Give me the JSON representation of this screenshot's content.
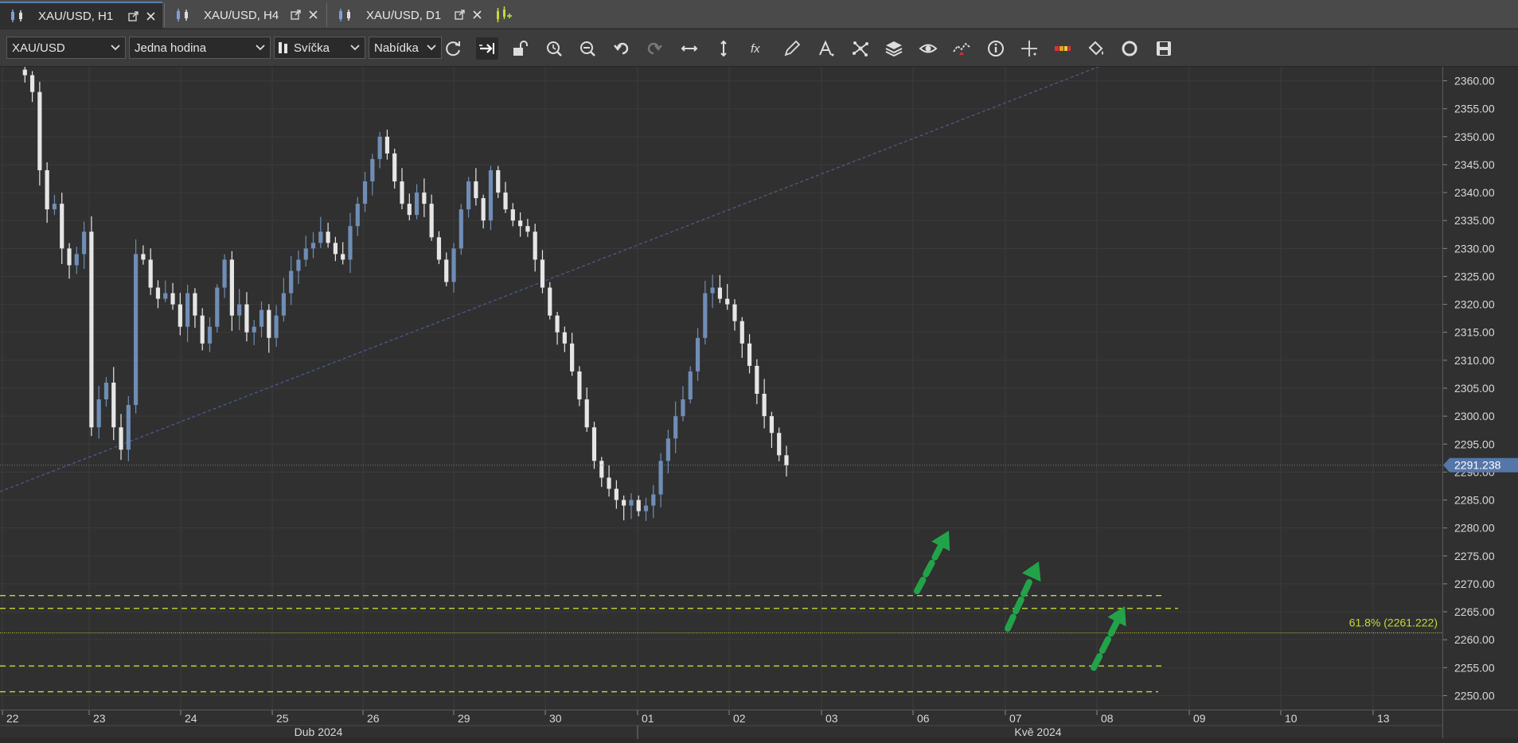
{
  "tabs": [
    {
      "label": "XAU/USD, H1",
      "active": true
    },
    {
      "label": "XAU/USD, H4",
      "active": false
    },
    {
      "label": "XAU/USD, D1",
      "active": false
    }
  ],
  "toolbar": {
    "instrument": "XAU/USD",
    "period": "Jedna hodina",
    "chart_type": "Svíčka",
    "price_side": "Nabídka",
    "icons": [
      "refresh-icon",
      "shift-chart-icon",
      "lock-icon",
      "zoom-clock-icon",
      "zoom-out-icon",
      "undo-icon",
      "redo-icon",
      "horizontal-resize-icon",
      "vertical-resize-icon",
      "fx-indicators-icon",
      "pencil-icon",
      "text-tool-icon",
      "patterns-icon",
      "layers-icon",
      "eye-icon",
      "signals-icon",
      "info-icon",
      "crosshair-icon",
      "heatmap-icon",
      "paint-bucket-icon",
      "circle-refresh-icon",
      "save-icon"
    ]
  },
  "chart_data": {
    "type": "candlestick",
    "ylim": [
      2247.5,
      2362.5
    ],
    "y_ticks": [
      "2250.00",
      "2255.00",
      "2260.00",
      "2265.00",
      "2270.00",
      "2275.00",
      "2280.00",
      "2285.00",
      "2290.00",
      "2295.00",
      "2300.00",
      "2305.00",
      "2310.00",
      "2315.00",
      "2320.00",
      "2325.00",
      "2330.00",
      "2335.00",
      "2340.00",
      "2345.00",
      "2350.00",
      "2355.00",
      "2360.00"
    ],
    "x_days": [
      "22",
      "23",
      "24",
      "25",
      "26",
      "29",
      "30",
      "01",
      "02",
      "03",
      "06",
      "07",
      "08",
      "09",
      "10",
      "13"
    ],
    "x_months": [
      "Dub 2024",
      "Kvě 2024"
    ],
    "current_price": "2291.238",
    "fib_label": "61.8% (2261.222)",
    "fib_level": 2261.222,
    "dashed_levels": [
      2267.9,
      2265.6,
      2255.3,
      2250.7
    ],
    "close_path": [
      2362,
      2361,
      2358,
      2344,
      2337,
      2338,
      2330,
      2327,
      2329,
      2333,
      2298,
      2303,
      2306,
      2298,
      2294,
      2302,
      2329,
      2328,
      2323,
      2321,
      2322,
      2320,
      2316,
      2322,
      2318,
      2313,
      2316,
      2323,
      2328,
      2318,
      2320,
      2315,
      2316,
      2319,
      2314,
      2318,
      2322,
      2326,
      2328,
      2330,
      2331,
      2333,
      2331,
      2329,
      2328,
      2334,
      2338,
      2342,
      2346,
      2350,
      2347,
      2342,
      2338,
      2336,
      2340,
      2338,
      2332,
      2328,
      2324,
      2330,
      2337,
      2342,
      2339,
      2335,
      2344,
      2340,
      2337,
      2335,
      2334,
      2333,
      2328,
      2323,
      2318,
      2315,
      2313,
      2308,
      2303,
      2298,
      2292,
      2289,
      2287,
      2285,
      2284,
      2285,
      2283,
      2284,
      2286,
      2292,
      2296,
      2300,
      2303,
      2308,
      2314,
      2322,
      2323,
      2321,
      2320,
      2317,
      2313,
      2309,
      2304,
      2300,
      2297,
      2293,
      2291.2
    ]
  },
  "colors": {
    "bull": "#6f8db5",
    "bear": "#e6e6e6",
    "fib": "#c9d83a",
    "arrow": "#22a34a",
    "trend": "#4c5a8c",
    "price_tag": "#5576a8"
  }
}
